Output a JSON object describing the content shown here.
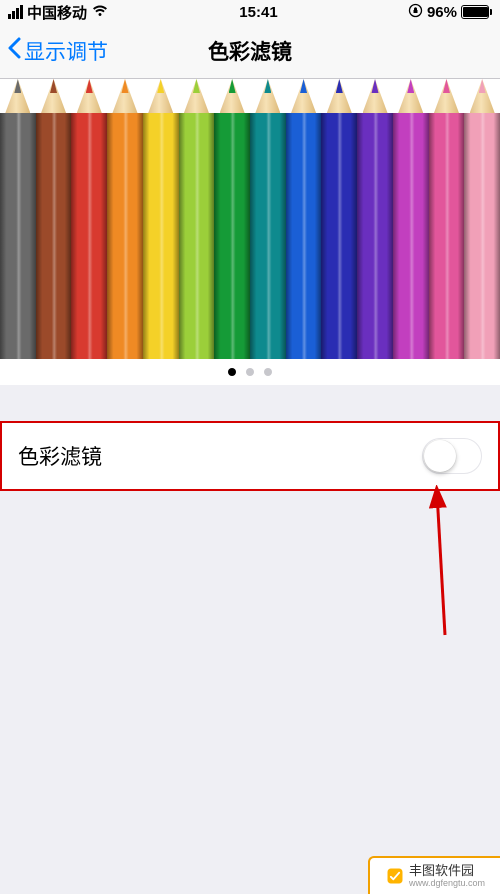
{
  "status": {
    "carrier": "中国移动",
    "time": "15:41",
    "battery_pct": "96%"
  },
  "nav": {
    "back_label": "显示调节",
    "title": "色彩滤镜"
  },
  "pencils": {
    "colors": [
      "#6a6a6a",
      "#9b4a2a",
      "#d83a2f",
      "#ef8a24",
      "#f4d128",
      "#9bcf3a",
      "#159b37",
      "#0e8a8e",
      "#1a5fd6",
      "#2a2db3",
      "#6a2fbf",
      "#c23fbf",
      "#e2569b",
      "#f1a0b8"
    ]
  },
  "pager": {
    "count": 3,
    "active_index": 0
  },
  "setting": {
    "label": "色彩滤镜",
    "enabled": false
  },
  "watermark": {
    "name": "丰图软件园",
    "url": "www.dgfengtu.com"
  }
}
